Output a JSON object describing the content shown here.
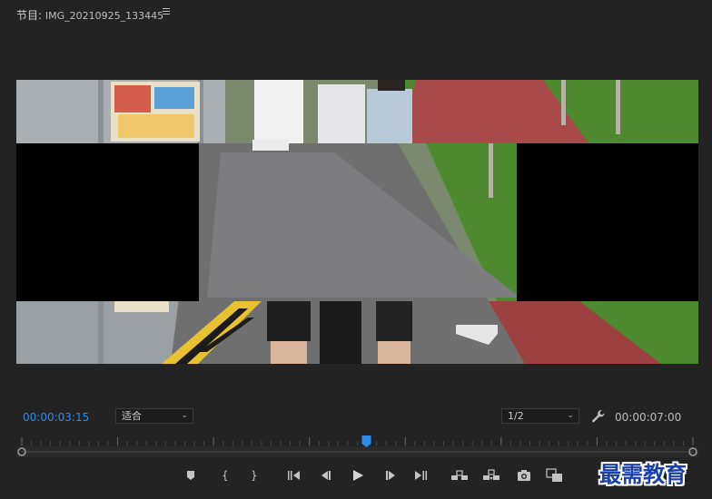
{
  "panel": {
    "prefix": "节目:",
    "clip_name": "IMG_20210925_133445",
    "menu_icon": "hamburger-menu-icon"
  },
  "playback": {
    "current_timecode": "00:00:03:15",
    "zoom_label": "适合",
    "resolution_label": "1/2",
    "duration_timecode": "00:00:07:00",
    "playhead_fraction": 0.5
  },
  "transport_icons": [
    "add-marker-icon",
    "mark-in-icon",
    "mark-out-icon",
    "go-to-in-icon",
    "step-back-icon",
    "play-icon",
    "step-forward-icon",
    "go-to-out-icon",
    "lift-icon",
    "extract-icon",
    "export-frame-icon",
    "compare-view-icon"
  ],
  "watermark": "最需教育",
  "colors": {
    "accent": "#2d8ceb",
    "background": "#232323"
  }
}
